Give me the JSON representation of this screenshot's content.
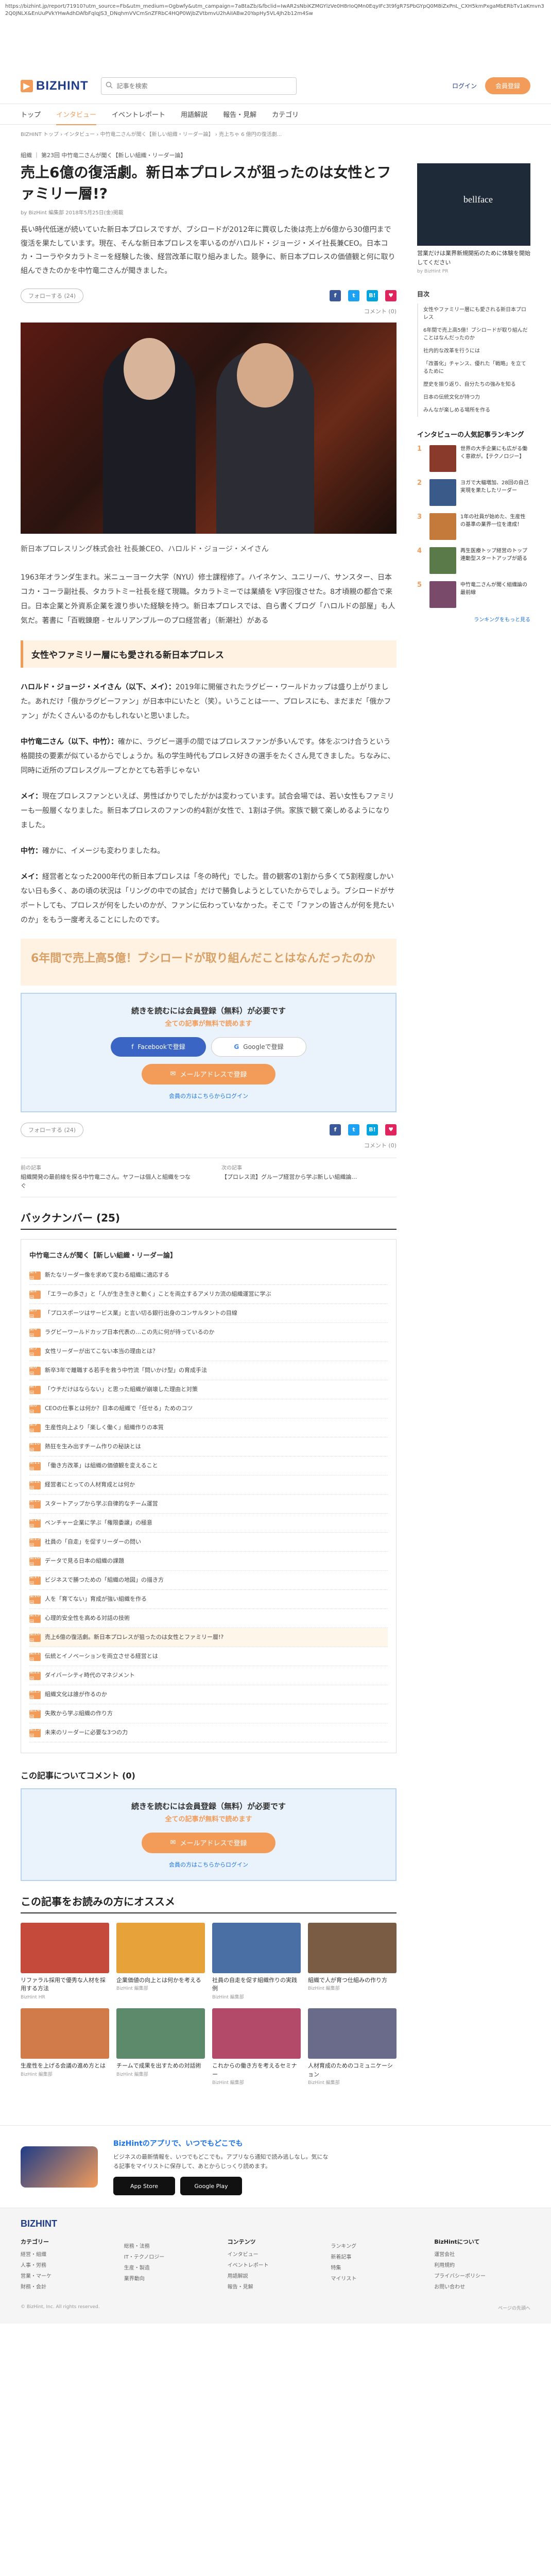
{
  "url": "https://bizhint.jp/report/71910?utm_source=Fb&utm_medium=Ogbwfy&utm_campaign=7aBtaZb/&fbclid=IwAR2sNbiKZMGYlzVe0H8rIoQMn0EqyIFc3t9fgR7SPbGYpQ0M8iZxPnL_CXH5kmPxgaMbERbTv1aKmvn32Q0JNLX&EnUuPVkYHwAdhDAfbFqlqJS3_DNqhmVVCmSnZFRbC4HQP0WjbZVtbmvU2hAiIABw20YapHy5VL4Jh2b12m4Sw",
  "header": {
    "logo": "BIZHINT",
    "search_placeholder": "記事を検索",
    "login": "ログイン",
    "register": "会員登録"
  },
  "nav": [
    "トップ",
    "インタビュー",
    "イベントレポート",
    "用語解説",
    "報告・見解",
    "カテゴリ"
  ],
  "breadcrumb": "BIZHINT トップ › インタビュー › 中竹竜二さんが聞く【新しい組織・リーダー論】 › 売上ちゃ 6 億円の復活劇...",
  "article": {
    "tags": "組織 ｜ 第23回 中竹竜二さんが聞く【新しい組織・リーダー論】",
    "title": "売上6億の復活劇。新日本プロレスが狙ったのは女性とファミリー層!?",
    "meta": "by BizHint 編集部  2018年5月25日(金)掲載",
    "lead": "長い時代低迷が続いていた新日本プロレスですが、ブシロードが2012年に買収した後は売上が6億から30億円まで復活を果たしています。現在、そんな新日本プロレスを率いるのがハロルド・ジョージ・メイ社長兼CEO。日本コカ・コーラやタカラトミーを経験した後、経営改革に取り組みました。競争に、新日本プロレスの価値観と何に取り組んできたのかを中竹竜二さんが聞きました。",
    "follow": "フォローする (24)",
    "comments": "コメント (0)",
    "caption": "新日本プロレスリング株式会社 社長兼CEO、ハロルド・ジョージ・メイさん",
    "bio": "1963年オランダ生まれ。米ニューヨーク大学（NYU）修士課程修了。ハイネケン、ユニリーバ、サンスター、日本コカ・コーラ副社長、タカラトミー社長を経て現職。タカラトミーでは業績を V字回復させた。8才頃親の都合で来日。日本企業と外資系企業を渡り歩いた経験を持つ。新日本プロレスでは、自ら書くブログ「ハロルドの部屋」も人気だ。著書に「百戦錬磨 ‐ セルリアンブルーのプロ経営者」（新潮社）がある",
    "bio_link": "ハロルドの部屋",
    "section1": "女性やファミリー層にも愛される新日本プロレス",
    "paras": [
      {
        "speaker": "ハロルド・ジョージ・メイさん（以下、メイ）：",
        "text": "2019年に開催されたラグビー・ワールドカップは盛り上がりました。あれだけ「俄かラグビーファン」が日本中にいたと（笑）。いうことは一ー、プロレスにも、まだまだ「俄かファン」がたくさんいるのかもしれないと思いました。"
      },
      {
        "speaker": "中竹竜二さん（以下、中竹）：",
        "text": "確かに、ラグビー選手の間ではプロレスファンが多いんです。体をぶつけ合うという格闘技の要素が似ているからでしょうか。私の学生時代もプロレス好きの選手をたくさん見てきました。ちなみに、同時に近所のプロレスグループとかとても若手じゃない"
      },
      {
        "speaker": "メイ：",
        "text": "現在プロレスファンといえば、男性ばかりでしたがかは変わっています。試合会場では、若い女性もファミリーも一般層くなりました。新日本プロレスのファンの約4割が女性で、1割は子供。家族で観て楽しめるようになりました。"
      },
      {
        "speaker": "中竹：",
        "text": "確かに、イメージも変わりましたね。"
      },
      {
        "speaker": "メイ：",
        "text": "経営者となった2000年代の新日本プロレスは「冬の時代」でした。昔の観客の1割から多くて5割程度しかいない日も多く、あの頃の状況は「リングの中での試合」だけで勝負しようとしていたからでしょう。ブシロードがサポートしても、プロレスが何をしたいのかが、ファンに伝わっていなかった。そこで「ファンの皆さんが何を見たいのか」をもう一度考えることにしたのです。"
      }
    ],
    "teaser": "6年間で売上高5億！ブシロードが取り組んだことはなんだったのか",
    "signup": {
      "line1": "続きを読むには会員登録（無料）が必要です",
      "line2": "全ての記事が無料で読めます",
      "facebook": "Facebookで登録",
      "google": "Googleで登録",
      "mail": "メールアドレスで登録",
      "login": "会員の方はこちらからログイン"
    },
    "prev_label": "前の記事",
    "prev_title": "組織開発の最前線を探る中竹竜二さん。ヤフーは個人と組織をつなぐ",
    "next_label": "次の記事",
    "next_title": "【プロレス流】グループ経営から学ぶ新しい組織論…",
    "backnumber_h": "バックナンバー (25)",
    "series_title": "中竹竜二さんが聞く【新しい組織・リーダー論】",
    "series": [
      "新たなリーダー像を求めて変わる組織に適応する",
      "「エラーの多さ」と「人が生き生きと動く」ことを両立するアメリカ流の組織運営に学ぶ",
      "「プロスポーツはサービス業」と言い切る銀行出身のコンサルタントの目線",
      "ラグビーワールドカップ日本代表の…この先に何が待っているのか",
      "女性リーダーが出てこない本当の理由とは？",
      "新卒3年で離職する若手を救う中竹流「問いかけ型」の育成手法",
      "「ウチだけはならない」と思った組織が崩壊した理由と対策",
      "CEOの仕事とは何か？日本の組織で「任せる」ためのコツ",
      "生産性向上より「楽しく働く」組織作りの本質",
      "熱狂を生み出すチーム作りの秘訣とは",
      "「働き方改革」は組織の価値観を変えること",
      "経営者にとっての人材育成とは何か",
      "スタートアップから学ぶ自律的なチーム運営",
      "ベンチャー企業に学ぶ「権限委譲」の極意",
      "社員の「自走」を促すリーダーの問い",
      "データで見る日本の組織の課題",
      "ビジネスで勝つための「組織の地図」の描き方",
      "人を「育てない」育成が強い組織を作る",
      "心理的安全性を高める対話の技術",
      "売上6億の復活劇。新日本プロレスが狙ったのは女性とファミリー層!?",
      "伝統とイノベーションを両立させる経営とは",
      "ダイバーシティ時代のマネジメント",
      "組織文化は誰が作るのか",
      "失敗から学ぶ組織の作り方",
      "未来のリーダーに必要な3つの力"
    ],
    "comments_h": "この記事についてコメント (0)",
    "rec_h": "この記事をお読みの方にオススメ",
    "recs": [
      {
        "title": "リファラル採用で優秀な人材を採用する方法",
        "src": "BizHint HR"
      },
      {
        "title": "企業価値の向上とは何かを考える",
        "src": "BizHint 編集部"
      },
      {
        "title": "社員の自走を促す組織作りの実践例",
        "src": "BizHint 編集部"
      },
      {
        "title": "組織で人が育つ仕組みの作り方",
        "src": "BizHint 編集部"
      },
      {
        "title": "生産性を上げる会議の進め方とは",
        "src": "BizHint 編集部"
      },
      {
        "title": "チームで成果を出すための対話術",
        "src": "BizHint 編集部"
      },
      {
        "title": "これからの働き方を考えるセミナー",
        "src": "BizHint 編集部"
      },
      {
        "title": "人材育成のためのコミュニケーション",
        "src": "BizHint 編集部"
      }
    ]
  },
  "sidebar": {
    "ad_brand": "bellface",
    "ad_text": "営業だけは業界新規開拓のために体験を開始してください",
    "ad_sub": "by BizHint PR",
    "toc_h": "目次",
    "toc": [
      "女性やファミリー層にも愛される新日本プロレス",
      "6年間で売上高5億！ブシロードが取り組んだことはなんだったのか",
      "社内的な改革を行うには",
      "「改善化」チャンス、優れた「戦略」を立てるために",
      "歴史を振り返り、自分たちの強みを知る",
      "日本の伝統文化が持つ力",
      "みんなが楽しめる場所を作る"
    ],
    "rank_h": "インタビューの人気記事ランキング",
    "ranks": [
      "世界の大手企業にも広がる働く意欲が。【テクノロジー】",
      "ヨガで大幅増加、28回の自己実現を果たしたリーダー",
      "1年の社員が始めた、生産性の基準の業界一位を達成！",
      "再生医療トップ経営のトップ連動型スタートアップが語る",
      "中竹竜二さんが聞く組織論の最前線"
    ],
    "rank_more": "ランキングをもっと見る"
  },
  "app": {
    "t1": "BizHintのアプリで、いつでもどこでも",
    "t2": "ビジネスの最新情報を、いつでもどこでも。アプリなら通知で読み逃しなし。気になる記事をマイリストに保存して、あとからじっくり読めます。",
    "appstore": "App Store",
    "googleplay": "Google Play"
  },
  "footer": {
    "logo": "BIZHINT",
    "cols": [
      {
        "h": "カテゴリー",
        "items": [
          "経営・組織",
          "人事・労務",
          "営業・マーケ",
          "財務・会計"
        ]
      },
      {
        "h": "",
        "items": [
          "総務・法務",
          "IT・テクノロジー",
          "生産・製造",
          "業界動向"
        ]
      },
      {
        "h": "コンテンツ",
        "items": [
          "インタビュー",
          "イベントレポート",
          "用語解説",
          "報告・見解"
        ]
      },
      {
        "h": "",
        "items": [
          "ランキング",
          "新着記事",
          "特集",
          "マイリスト"
        ]
      },
      {
        "h": "BizHintについて",
        "items": [
          "運営会社",
          "利用規約",
          "プライバシーポリシー",
          "お問い合わせ"
        ]
      }
    ],
    "copyright": "© BizHint, Inc. All rights reserved.",
    "pagetop": "ページの先頭へ"
  }
}
